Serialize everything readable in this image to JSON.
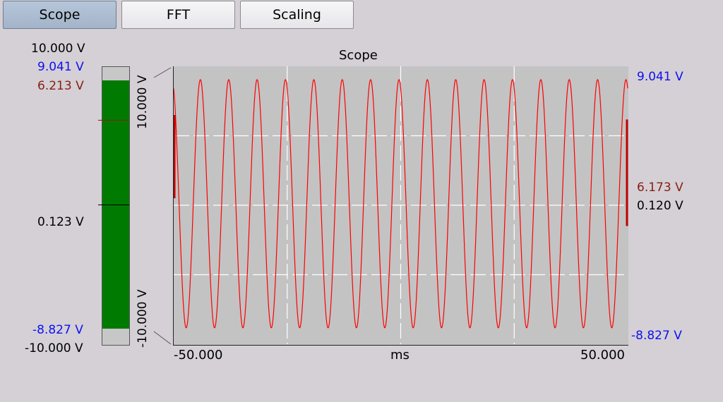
{
  "tabs": [
    {
      "label": "Scope",
      "active": true
    },
    {
      "label": "FFT",
      "active": false
    },
    {
      "label": "Scaling",
      "active": false
    }
  ],
  "meter": {
    "range_max_label": "10.000 V",
    "max_value_label": "9.041 V",
    "current_label": "6.213 V",
    "mean_label": "0.123 V",
    "min_value_label": "-8.827 V",
    "range_min_label": "-10.000 V",
    "axis_top_label": "10.000 V",
    "axis_bottom_label": "-10.000 V",
    "range_max": 10.0,
    "range_min": -10.0,
    "max_value": 9.041,
    "min_value": -8.827,
    "current_value": 6.213,
    "mean_value": 0.123,
    "fill_color": "#007a00"
  },
  "scope": {
    "title": "Scope",
    "x_min_label": "-50.000",
    "x_max_label": "50.000",
    "x_unit": "ms",
    "right_max_label": "9.041 V",
    "right_current_label": "6.173 V",
    "right_mean_label": "0.120 V",
    "right_min_label": "-8.827 V",
    "trace_color": "#ff0000",
    "grid_color": "#ffffff",
    "background_color": "#c3c3c3"
  },
  "chart_data": {
    "type": "line",
    "title": "Scope",
    "xlabel": "ms",
    "ylabel": "",
    "xlim": [
      -50,
      50
    ],
    "ylim": [
      -10,
      10
    ],
    "grid": true,
    "series": [
      {
        "waveform": "sine",
        "periods": 16,
        "max": 9.041,
        "min": -8.827,
        "offset": 0.12,
        "end_value": 6.173,
        "color": "#ff0000"
      }
    ]
  }
}
